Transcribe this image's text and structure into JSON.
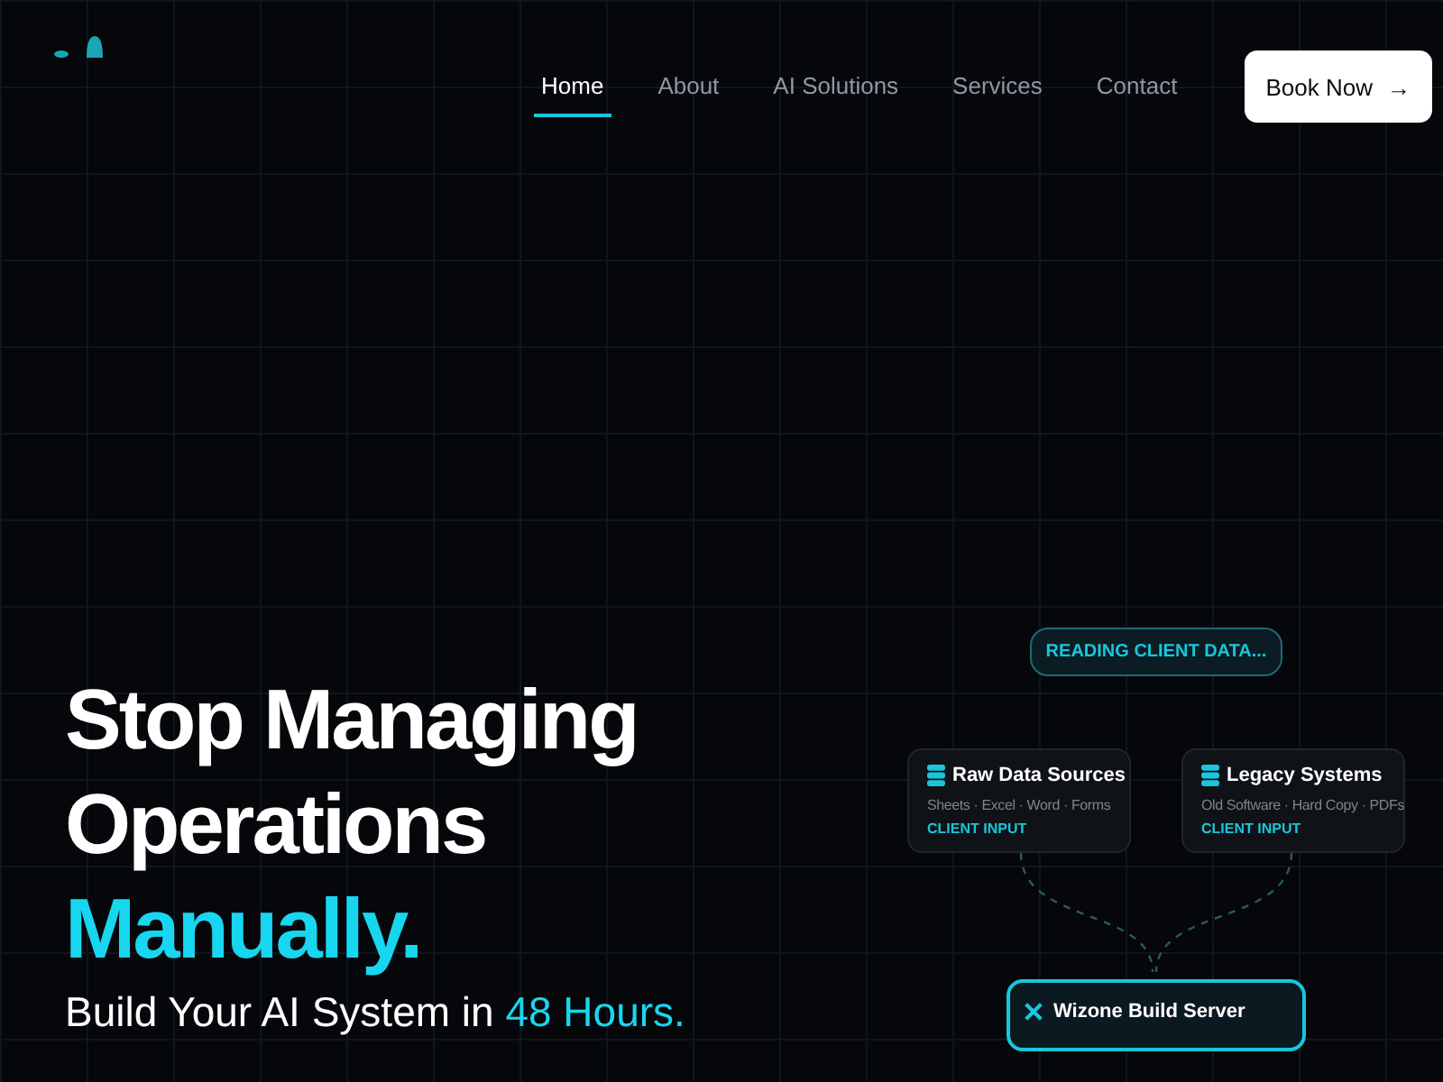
{
  "nav": {
    "items": [
      {
        "label": "Home",
        "selected": true
      },
      {
        "label": "About",
        "selected": false
      },
      {
        "label": "AI Solutions",
        "selected": false
      },
      {
        "label": "Services",
        "selected": false
      },
      {
        "label": "Contact",
        "selected": false
      }
    ],
    "cta": {
      "label": "Book Now",
      "icon": "→"
    }
  },
  "hero": {
    "heading": [
      {
        "text": "Stop Managing",
        "accent": false
      },
      {
        "text": "Operations",
        "accent": false
      },
      {
        "text": "Manually.",
        "accent": true
      }
    ],
    "subheading": [
      {
        "text": "Build Your AI System in ",
        "accent": false
      },
      {
        "text": "48 Hours.",
        "accent": true
      }
    ]
  },
  "diagram": {
    "status": "READING CLIENT DATA...",
    "sources": [
      {
        "title": "Raw Data Sources",
        "detail": "Sheets · Excel · Word · Forms",
        "tag": "CLIENT INPUT"
      },
      {
        "title": "Legacy Systems",
        "detail": "Old Software · Hard Copy · PDFs",
        "tag": "CLIENT INPUT"
      }
    ],
    "server": {
      "title": "Wizone Build Server"
    }
  }
}
